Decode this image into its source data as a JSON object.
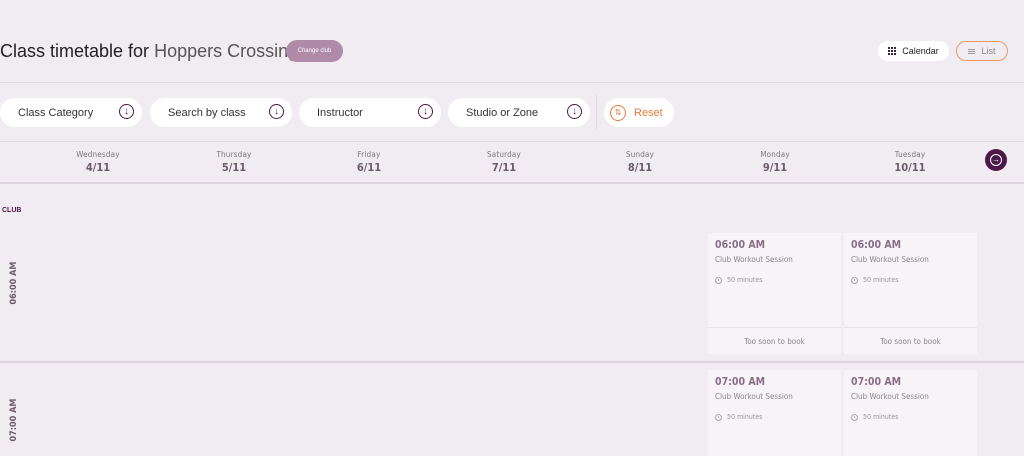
{
  "header": {
    "title_prefix": "Class timetable for",
    "club_name": "Hoppers Crossing",
    "change_club": "Change club",
    "view_calendar": "Calendar",
    "view_list": "List"
  },
  "filters": {
    "category": "Class Category",
    "search": "Search by class",
    "instructor": "Instructor",
    "studio": "Studio or Zone",
    "reset": "Reset"
  },
  "days": [
    {
      "name": "Wednesday",
      "date": "4/11"
    },
    {
      "name": "Thursday",
      "date": "5/11"
    },
    {
      "name": "Friday",
      "date": "6/11"
    },
    {
      "name": "Saturday",
      "date": "7/11"
    },
    {
      "name": "Sunday",
      "date": "8/11"
    },
    {
      "name": "Monday",
      "date": "9/11"
    },
    {
      "name": "Tuesday",
      "date": "10/11"
    }
  ],
  "section": "CLUB",
  "time_slots": [
    "06:00 AM",
    "07:00 AM"
  ],
  "cards": [
    {
      "time": "06:00 AM",
      "name": "Club Workout Session",
      "duration": "50 minutes",
      "status": "Too soon to book"
    },
    {
      "time": "06:00 AM",
      "name": "Club Workout Session",
      "duration": "50 minutes",
      "status": "Too soon to book"
    },
    {
      "time": "07:00 AM",
      "name": "Club Workout Session",
      "duration": "50 minutes"
    },
    {
      "time": "07:00 AM",
      "name": "Club Workout Session",
      "duration": "50 minutes"
    }
  ],
  "colors": {
    "brand": "#4b1a48",
    "accent": "#e47a3b",
    "background": "#f1ecf1"
  }
}
